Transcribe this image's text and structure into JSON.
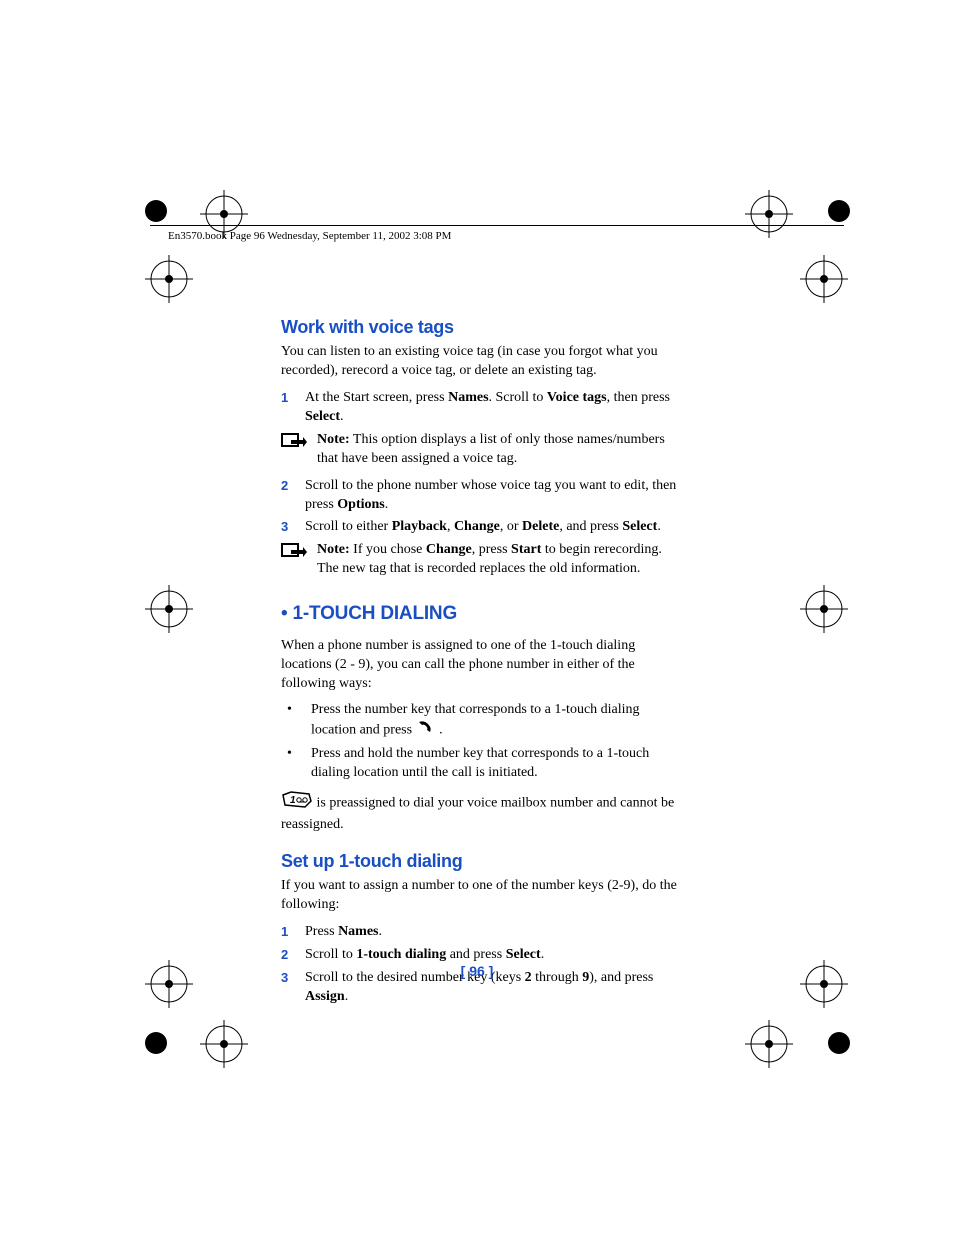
{
  "header": "En3570.book  Page 96  Wednesday, September 11, 2002  3:08 PM",
  "section1_title": "Work with voice tags",
  "section1_intro": "You can listen to an existing voice tag (in case you forgot what you recorded), rerecord a voice tag, or delete an existing tag.",
  "s1_step1_num": "1",
  "s1_step1_a": "At the Start screen, press ",
  "s1_step1_b": "Names",
  "s1_step1_c": ". Scroll to ",
  "s1_step1_d": "Voice tags",
  "s1_step1_e": ", then press ",
  "s1_step1_f": "Select",
  "s1_step1_g": ".",
  "s1_note1_a": "Note:",
  "s1_note1_b": "  This option displays a list of only those names/numbers that have been assigned a voice tag.",
  "s1_step2_num": "2",
  "s1_step2_a": "Scroll to the phone number whose voice tag you want to edit, then press ",
  "s1_step2_b": "Options",
  "s1_step2_c": ".",
  "s1_step3_num": "3",
  "s1_step3_a": "Scroll to either ",
  "s1_step3_b": "Playback",
  "s1_step3_c": ", ",
  "s1_step3_d": "Change",
  "s1_step3_e": ", or ",
  "s1_step3_f": "Delete",
  "s1_step3_g": ", and press ",
  "s1_step3_h": "Select",
  "s1_step3_i": ".",
  "s1_note2_a": "Note:",
  "s1_note2_b": " If you chose ",
  "s1_note2_c": "Change",
  "s1_note2_d": ", press ",
  "s1_note2_e": "Start",
  "s1_note2_f": " to begin rerecording. The new tag that is recorded replaces the old information.",
  "section2_bullet": " •",
  "section2_title": "1-TOUCH DIALING",
  "section2_intro": "When a phone number is assigned to one of the 1-touch dialing locations (2 - 9), you can call the phone number in either of the following ways:",
  "s2_b1_a": "Press the number key that corresponds to a 1-touch dialing location and press ",
  "s2_b1_b": " .",
  "s2_b2": "Press and hold the number key that corresponds to a 1-touch dialing location until the call is initiated.",
  "s2_after_a": " is preassigned to dial your voice mailbox number and cannot be reassigned.",
  "section3_title": "Set up 1-touch dialing",
  "section3_intro": "If you want to assign a number to one of the number keys (2-9), do the following:",
  "s3_step1_num": "1",
  "s3_step1_a": "Press ",
  "s3_step1_b": "Names",
  "s3_step1_c": ".",
  "s3_step2_num": "2",
  "s3_step2_a": "Scroll to ",
  "s3_step2_b": "1-touch dialing",
  "s3_step2_c": " and press ",
  "s3_step2_d": "Select",
  "s3_step2_e": ".",
  "s3_step3_num": "3",
  "s3_step3_a": "Scroll to the desired number key (keys ",
  "s3_step3_b": "2",
  "s3_step3_c": " through ",
  "s3_step3_d": "9",
  "s3_step3_e": "), and press ",
  "s3_step3_f": "Assign",
  "s3_step3_g": ".",
  "page_number": "[ 96 ]",
  "bullet": "•"
}
